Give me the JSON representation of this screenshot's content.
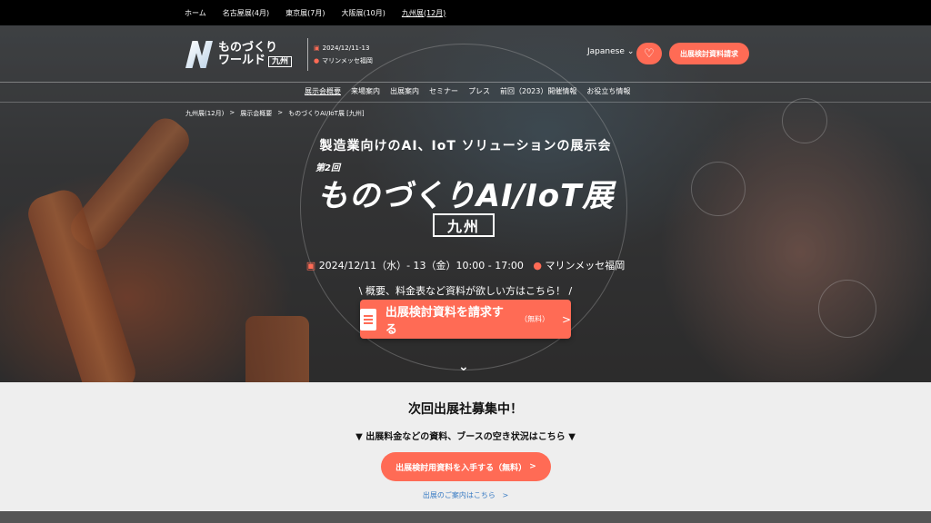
{
  "topbar": {
    "links": [
      "ホーム",
      "名古屋展(4月)",
      "東京展(7月)",
      "大阪展(10月)",
      "九州展(12月)"
    ]
  },
  "header": {
    "logo_line1": "ものづくり",
    "logo_line2": "ワールド",
    "logo_badge": "九州",
    "date": "2024/12/11-13",
    "venue": "マリンメッセ福岡",
    "language": "Japanese",
    "request_button": "出展検討資料請求"
  },
  "nav": [
    "展示会概要",
    "来場案内",
    "出展案内",
    "セミナー",
    "プレス",
    "前回（2023）開催情報",
    "お役立ち情報"
  ],
  "breadcrumb": [
    "九州展(12月)",
    "展示会概要",
    "ものづくりAI/IoT展 [九州]"
  ],
  "hero": {
    "subtitle": "製造業向けのAI、IoT ソリューションの展示会",
    "edition": "第2回",
    "title": "ものづくりAI/IoT展",
    "region": "九州",
    "date": "2024/12/11（水）- 13（金）10:00 - 17:00",
    "venue": "マリンメッセ福岡",
    "promo": "\\ 概要、料金表など資料が欲しい方はこちら！ /",
    "cta_main": "出展検討資料を請求する",
    "cta_sub": "（無料）"
  },
  "lower": {
    "title": "次回出展社募集中！",
    "subtitle": "▼ 出展料金などの資料、ブースの空き状況はこちら ▼",
    "cta": "出展検討用資料を入手する（無料）",
    "guide_link": "出展のご案内はこちら"
  },
  "colors": {
    "accent": "#ff6b55",
    "topbar": "#000000",
    "link": "#3a7cc4"
  }
}
